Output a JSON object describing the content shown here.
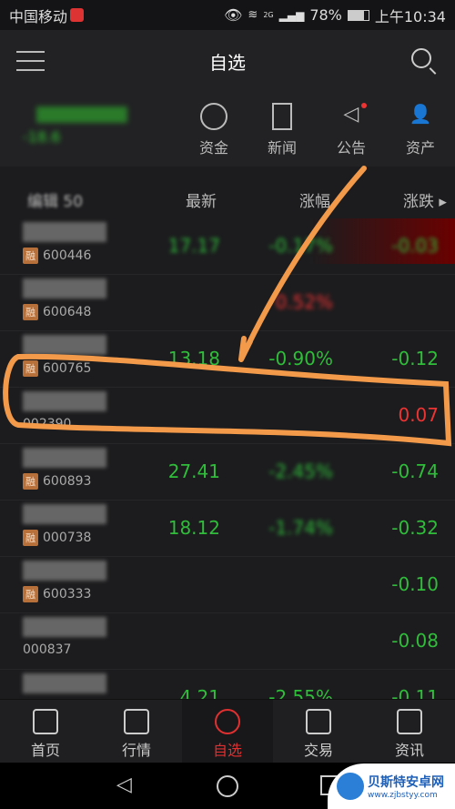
{
  "status_bar": {
    "carrier": "中国移动",
    "network": "2G",
    "battery": "78%",
    "time": "上午10:34"
  },
  "nav": {
    "title": "自选"
  },
  "summary": {
    "index_change": "-18.6",
    "quick_links": [
      {
        "label": "资金",
        "icon": "fund-icon"
      },
      {
        "label": "新闻",
        "icon": "news-icon"
      },
      {
        "label": "公告",
        "icon": "announcement-icon",
        "badge": true
      },
      {
        "label": "资产",
        "icon": "asset-icon"
      }
    ]
  },
  "table_header": {
    "edit": "编辑 50",
    "latest": "最新",
    "change_pct": "涨幅",
    "change": "涨跌"
  },
  "rows": [
    {
      "code": "600446",
      "margin": "融",
      "price": "17.17",
      "pct": "-0.17%",
      "chg": "-0.03",
      "dir": "down",
      "flash": true
    },
    {
      "code": "600648",
      "margin": "融",
      "price": "",
      "pct": "0.52%",
      "chg": "",
      "dir": "up"
    },
    {
      "code": "600765",
      "margin": "融",
      "price": "13.18",
      "pct": "-0.90%",
      "chg": "-0.12",
      "dir": "down"
    },
    {
      "code": "002390",
      "margin": "",
      "price": "",
      "pct": "",
      "chg": "0.07",
      "dir": "up"
    },
    {
      "code": "600893",
      "margin": "融",
      "price": "27.41",
      "pct": "-2.45%",
      "chg": "-0.74",
      "dir": "down"
    },
    {
      "code": "000738",
      "margin": "融",
      "price": "18.12",
      "pct": "-1.74%",
      "chg": "-0.32",
      "dir": "down"
    },
    {
      "code": "600333",
      "margin": "融",
      "price": "",
      "pct": "",
      "chg": "-0.10",
      "dir": "down"
    },
    {
      "code": "000837",
      "margin": "",
      "price": "",
      "pct": "",
      "chg": "-0.08",
      "dir": "down"
    },
    {
      "code": "",
      "margin": "",
      "price": "4.21",
      "pct": "-2.55%",
      "chg": "-0.11",
      "dir": "down"
    }
  ],
  "tabs": [
    {
      "label": "首页",
      "icon": "home-icon"
    },
    {
      "label": "行情",
      "icon": "chart-icon"
    },
    {
      "label": "自选",
      "icon": "watchlist-icon",
      "active": true
    },
    {
      "label": "交易",
      "icon": "trade-icon"
    },
    {
      "label": "资讯",
      "icon": "info-icon"
    }
  ],
  "watermark": {
    "name": "贝斯特安卓网",
    "url": "www.zjbstyy.com"
  },
  "colors": {
    "up": "#e33333",
    "down": "#2fbd3a",
    "accent": "#e03030",
    "annotation": "#f29a4a"
  }
}
